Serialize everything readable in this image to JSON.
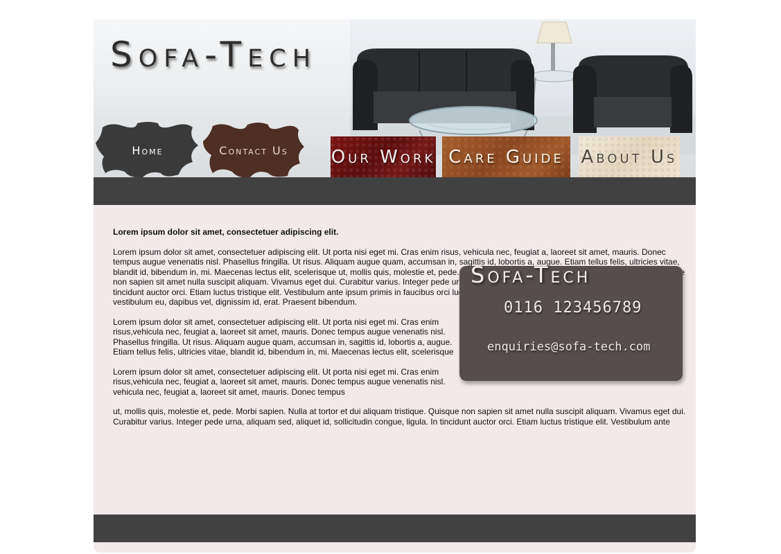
{
  "brand": {
    "logo_text": "Sofa-Tech"
  },
  "nav": {
    "home": "Home",
    "contact": "Contact Us",
    "our_work": "Our Work",
    "care_guide": "Care Guide",
    "about_us": "About Us"
  },
  "colors": {
    "dark_bar": "#424142",
    "page_bg": "#f1e9ea",
    "card_bg": "#554d4e",
    "leather_red": "#6b1111",
    "leather_tan": "#95512a",
    "leather_cream": "#e8dcc6"
  },
  "main": {
    "lead": "Lorem ipsum dolor sit amet, consectetuer adipiscing elit.",
    "paragraphs": [
      "Lorem ipsum dolor sit amet, consectetuer adipiscing elit. Ut porta nisi eget mi. Cras enim risus, vehicula nec, feugiat a, laoreet sit amet, mauris. Donec tempus augue venenatis nisl. Phasellus fringilla. Ut risus. Aliquam augue quam, accumsan in, sagittis id, lobortis a, augue. Etiam tellus felis, ultricies vitae, blandit id, bibendum in, mi. Maecenas lectus elit, scelerisque ut, mollis quis, molestie et, pede. Morbi sapien. Nulla at tortor et dui aliquam tristique. Quisque non sapien sit amet nulla suscipit aliquam. Vivamus eget dui. Curabitur varius. Integer pede urna, aliquam sed, aliquet id, sollicitudin congue, ligula. In tincidunt auctor orci. Etiam luctus tristique elit. Vestibulum ante ipsum primis in faucibus orci luctus et ultrices posuere cubilia Curae; Maecenas ante purus, vestibulum eu, dapibus vel, dignissim id, erat. Praesent bibendum.",
      "Lorem ipsum dolor sit amet, consectetuer adipiscing elit. Ut porta nisi eget mi. Cras enim risus,vehicula nec, feugiat a, laoreet sit amet, mauris. Donec tempus augue venenatis nisl. Phasellus fringilla. Ut risus. Aliquam augue quam, accumsan in, sagittis id, lobortis a, augue. Etiam tellus felis, ultricies vitae, blandit id, bibendum in, mi. Maecenas lectus elit, scelerisque",
      "Lorem ipsum dolor sit amet, consectetuer adipiscing elit. Ut porta nisi eget mi. Cras enim risus,vehicula nec, feugiat a, laoreet sit amet, mauris. Donec tempus augue venenatis nisl. vehicula nec, feugiat a, laoreet sit amet, mauris. Donec tempus",
      "ut, mollis quis, molestie et, pede. Morbi sapien. Nulla at tortor et dui aliquam tristique. Quisque non sapien sit amet nulla suscipit aliquam. Vivamus eget dui. Curabitur varius. Integer pede urna, aliquam sed, aliquet id, sollicitudin congue, ligula. In tincidunt auctor orci. Etiam luctus tristique elit. Vestibulum ante"
    ]
  },
  "contact_card": {
    "title": "Sofa-Tech",
    "phone": "0116 123456789",
    "email": "enquiries@sofa-tech.com"
  }
}
